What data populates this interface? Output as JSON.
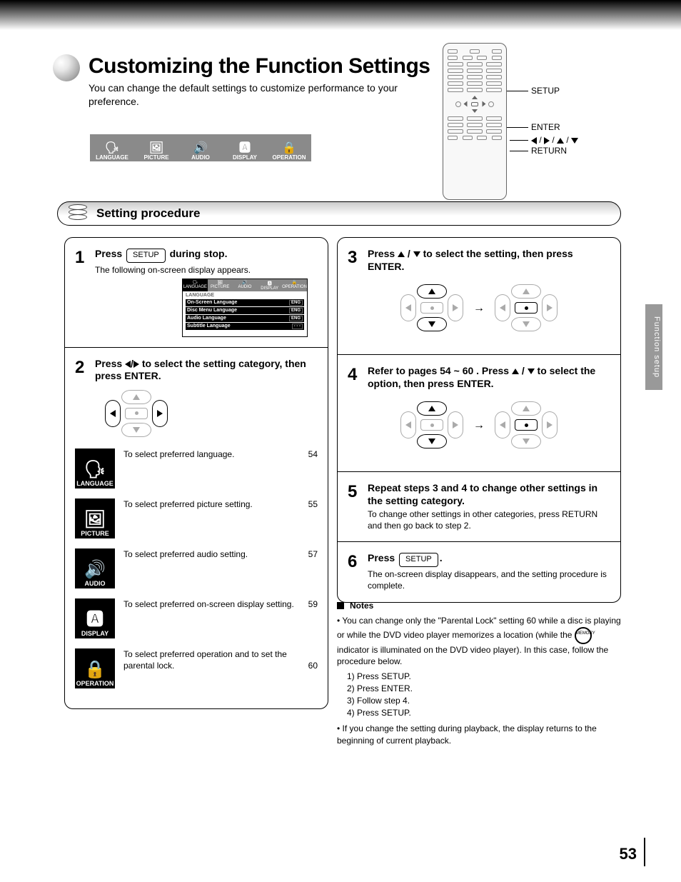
{
  "header": {
    "title": "Customizing the Function Settings",
    "subtitle": "You can change the default settings to customize performance to your preference."
  },
  "menu_icons": {
    "language": "LANGUAGE",
    "picture": "PICTURE",
    "audio": "AUDIO",
    "display": "DISPLAY",
    "operation": "OPERATION"
  },
  "remote_labels": {
    "setup": "SETUP",
    "enter": "ENTER",
    "dirpad": "/ / / /",
    "return": "RETURN"
  },
  "procedure": {
    "title": "Setting procedure"
  },
  "step1": {
    "num": "1",
    "head_before": "Press",
    "head_btn": "SETUP",
    "head_after": "during stop.",
    "sub": "The following on-screen display appears."
  },
  "osd": {
    "tabs": [
      "LANGUAGE",
      "PICTURE",
      "AUDIO",
      "DISPLAY",
      "OPERATION"
    ],
    "section": "LANGUAGE",
    "rows": [
      {
        "label": "On-Screen Language",
        "val": "ENG"
      },
      {
        "label": "Disc Menu Language",
        "val": "ENG"
      },
      {
        "label": "Audio Language",
        "val": "ENG"
      },
      {
        "label": "Subtitle Language",
        "val": "- - -"
      }
    ]
  },
  "step2": {
    "num": "2",
    "head_a": "Press",
    "head_b": "/",
    "head_c": "to select the setting category, then press ENTER.",
    "items": [
      {
        "label": "LANGUAGE",
        "glyph": "🗣",
        "desc": "To select preferred language.",
        "pg": "54"
      },
      {
        "label": "PICTURE",
        "glyph": "🖼",
        "desc": "To select preferred picture setting.",
        "pg": "55"
      },
      {
        "label": "AUDIO",
        "glyph": "🔊",
        "desc": "To select preferred audio setting.",
        "pg": "57"
      },
      {
        "label": "DISPLAY",
        "glyph": "🅰",
        "desc": "To select preferred on-screen display setting.",
        "pg": "59"
      },
      {
        "label": "OPERATION",
        "glyph": "🔒",
        "desc": "To select preferred operation and to set the parental lock.",
        "pg": "60"
      }
    ]
  },
  "step3": {
    "num": "3",
    "head": "Press     /     to select the setting, then press ENTER."
  },
  "step4": {
    "num": "4",
    "head_a": "Refer to pages",
    "head_b": "54",
    "head_c": "~",
    "head_d": "60",
    "head_e": ". Press     /     to select the option, then press ENTER."
  },
  "step5": {
    "num": "5",
    "head": "Repeat steps 3 and 4 to change other settings in the setting category.",
    "sub": "To change other settings in other categories, press RETURN and then go back to step 2."
  },
  "step6": {
    "num": "6",
    "head_before": "Press",
    "head_btn": "SETUP",
    "head_after": ".",
    "sub": "The on-screen display disappears, and the setting procedure is complete."
  },
  "notes": {
    "heading": "Notes",
    "n1a": "• You can change only the \"Parental Lock\" setting",
    "n1pg": "60",
    "n1b": "while a disc is playing or while the DVD video player memorizes a location (while the        indicator is illuminated on the DVD video player). In this case, follow the procedure below.",
    "memory_label": "MEMORY",
    "steps": [
      "1) Press SETUP.",
      "2) Press ENTER.",
      "3) Follow step 4.",
      "4) Press SETUP."
    ],
    "n2": "• If you change the setting during playback, the display returns to the beginning of current playback."
  },
  "sidebar": "Function setup",
  "page": "53"
}
